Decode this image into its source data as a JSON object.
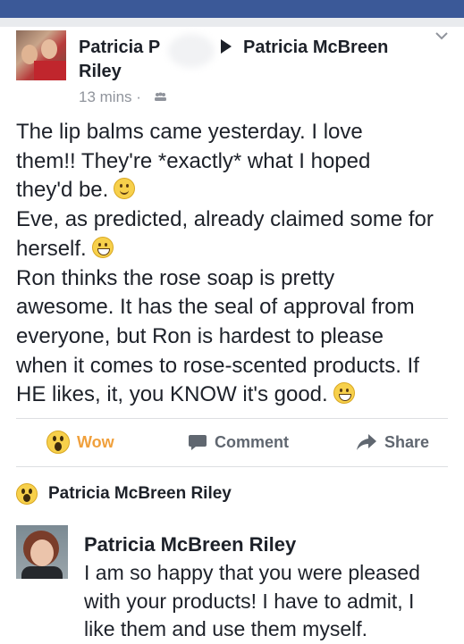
{
  "post": {
    "author_line1": "Patricia P",
    "author_line2": "Riley",
    "target": "Patricia McBreen",
    "time": "13 mins",
    "separator": "·",
    "privacy_icon": "friends-icon",
    "body_lines": [
      "The lip balms came yesterday.  I love",
      "them!!  They're *exactly* what I hoped",
      "they'd be.",
      "Eve, as predicted, already claimed some for",
      "herself.",
      "Ron thinks the rose soap is pretty",
      "awesome.  It has the seal of approval from",
      "everyone, but Ron is hardest to please",
      "when it comes to rose-scented products.  If",
      "HE likes, it, you KNOW it's good."
    ]
  },
  "actions": {
    "wow_label": "Wow",
    "comment_label": "Comment",
    "share_label": "Share"
  },
  "reaction": {
    "name": "Patricia McBreen Riley",
    "icon": "wow-icon"
  },
  "comment": {
    "author": "Patricia McBreen Riley",
    "lines": [
      "I am so happy that you were pleased",
      "with your products! I have to admit, I",
      "like them and use them myself."
    ]
  },
  "colors": {
    "topbar": "#3b5998",
    "wow_accent": "#f0a03c",
    "action_gray": "#606770",
    "meta_gray": "#90949c"
  }
}
